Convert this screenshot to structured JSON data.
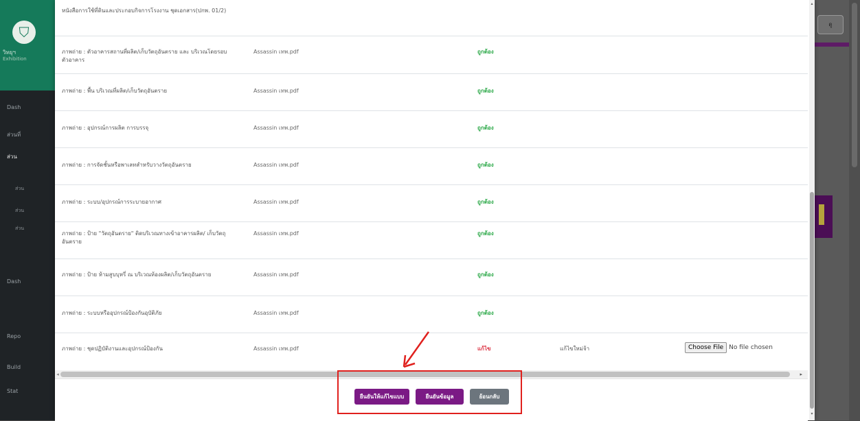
{
  "background_app": {
    "header_button": "ดู",
    "brand_title": "วิทยุฯ",
    "brand_subtitle": "Exhibition",
    "nav": [
      "Dash",
      "ส่วนที่",
      "ส่วน",
      "ส่วน",
      "ส่วน",
      "ส่วน",
      "Dash",
      "Repo",
      "Build",
      "Stat"
    ]
  },
  "rows": [
    {
      "name": "หนังสือการใช้ที่ดินและประกอบกิจการโรงงาน ชุดเอกสาร(ปกพ. 01/2)",
      "file": "",
      "status": "",
      "note": ""
    },
    {
      "name": "ภาพถ่าย : ตัวอาคารสถานที่ผลิต/เก็บวัตถุอันตราย และ บริเวณโดยรอบตัวอาคาร",
      "file": "Assassin เทพ.pdf",
      "status": "ถูกต้อง",
      "note": ""
    },
    {
      "name": "ภาพถ่าย : พื้น บริเวณที่ผลิต/เก็บวัตถุอันตราย",
      "file": "Assassin เทพ.pdf",
      "status": "ถูกต้อง",
      "note": ""
    },
    {
      "name": "ภาพถ่าย : อุปกรณ์การผลิต การบรรจุ",
      "file": "Assassin เทพ.pdf",
      "status": "ถูกต้อง",
      "note": ""
    },
    {
      "name": "ภาพถ่าย : การจัดชั้นหรือพาเลทสำหรับวางวัตถุอันตราย",
      "file": "Assassin เทพ.pdf",
      "status": "ถูกต้อง",
      "note": ""
    },
    {
      "name": "ภาพถ่าย : ระบบ/อุปกรณ์การระบายอากาศ",
      "file": "Assassin เทพ.pdf",
      "status": "ถูกต้อง",
      "note": ""
    },
    {
      "name": "ภาพถ่าย : ป้าย \"วัตถุอันตราย\" ติดบริเวณทางเข้าอาคารผลิต/ เก็บวัตถุอันตราย",
      "file": "Assassin เทพ.pdf",
      "status": "ถูกต้อง",
      "note": ""
    },
    {
      "name": "ภาพถ่าย : ป้าย ห้ามสูบบุหรี่ ณ บริเวณห้องผลิต/เก็บวัตถุอันตราย",
      "file": "Assassin เทพ.pdf",
      "status": "ถูกต้อง",
      "note": ""
    },
    {
      "name": "ภาพถ่าย : ระบบหรืออุปกรณ์ป้องกันอุบัติภัย",
      "file": "Assassin เทพ.pdf",
      "status": "ถูกต้อง",
      "note": ""
    },
    {
      "name": "ภาพถ่าย : ชุดปฏิบัติงานและอุปกรณ์ป้องกัน",
      "file": "Assassin เทพ.pdf",
      "status": "แก้ไข",
      "note": "แก้ไขใหม่จ้า",
      "file_input": {
        "button": "Choose File",
        "text": "No file chosen"
      }
    }
  ],
  "footer": {
    "confirm_edit_label": "ยืนยันให้แก้ไขแบบ",
    "save_label": "ยืนยันข้อมูล",
    "back_label": "ย้อนกลับ"
  },
  "colors": {
    "primary_purple": "#7b1a85",
    "secondary_gray": "#6c757d",
    "status_ok": "#28a745",
    "status_fix": "#dc3545",
    "annotation_red": "#e0201d"
  }
}
